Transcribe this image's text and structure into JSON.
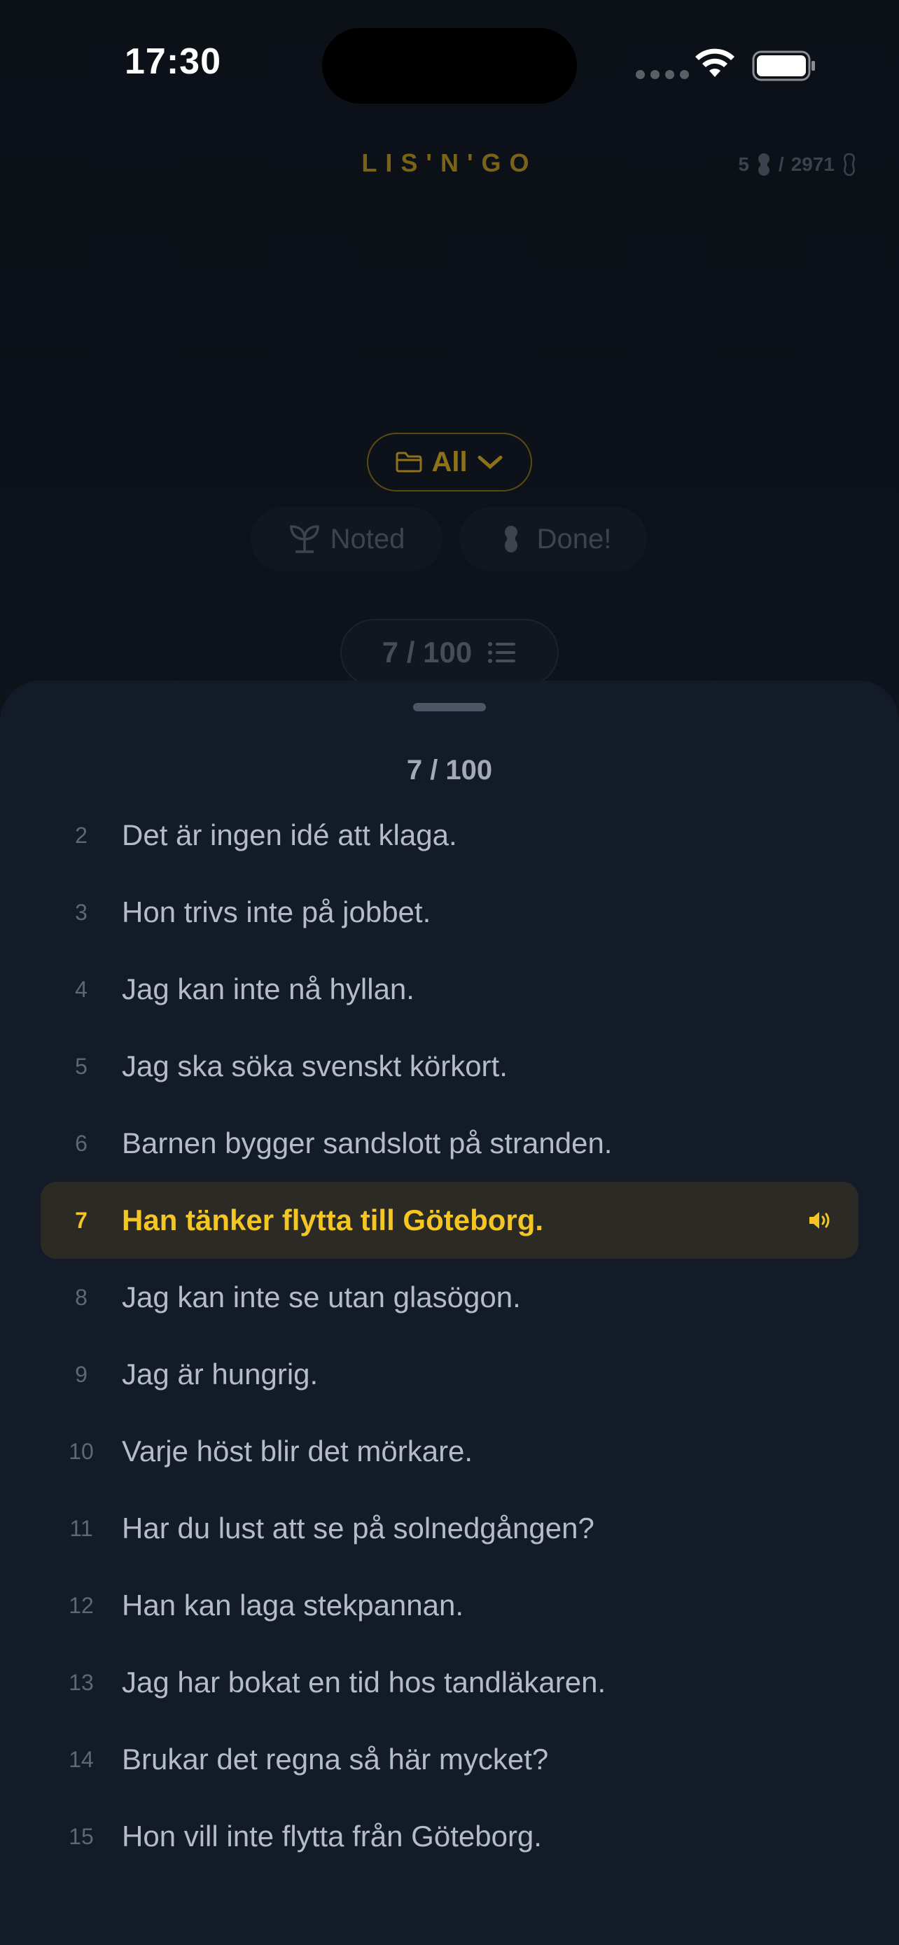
{
  "status": {
    "time": "17:30"
  },
  "header": {
    "title": "LIS'N'GO",
    "score_current": "5",
    "score_sep": "/",
    "score_total": "2971"
  },
  "filters": {
    "folder_label": "All",
    "noted_label": "Noted",
    "done_label": "Done!"
  },
  "counter": {
    "label": "7 / 100"
  },
  "sheet": {
    "title": "7 / 100",
    "active_index": 5,
    "items": [
      {
        "num": "2",
        "text": "Det är ingen idé att klaga."
      },
      {
        "num": "3",
        "text": "Hon trivs inte på jobbet."
      },
      {
        "num": "4",
        "text": "Jag kan inte nå hyllan."
      },
      {
        "num": "5",
        "text": "Jag ska söka svenskt körkort."
      },
      {
        "num": "6",
        "text": "Barnen bygger sandslott på stranden."
      },
      {
        "num": "7",
        "text": "Han tänker flytta till Göteborg."
      },
      {
        "num": "8",
        "text": "Jag kan inte se utan glasögon."
      },
      {
        "num": "9",
        "text": "Jag är hungrig."
      },
      {
        "num": "10",
        "text": "Varje höst blir det mörkare."
      },
      {
        "num": "11",
        "text": "Har du lust att se på solnedgången?"
      },
      {
        "num": "12",
        "text": "Han kan laga stekpannan."
      },
      {
        "num": "13",
        "text": "Jag har bokat en tid hos tandläkaren."
      },
      {
        "num": "14",
        "text": "Brukar det regna så här mycket?"
      },
      {
        "num": "15",
        "text": "Hon vill inte flytta från Göteborg."
      }
    ]
  },
  "colors": {
    "accent": "#f4c623",
    "sheet_bg": "#131a28",
    "active_row_bg": "#2b2a24"
  }
}
